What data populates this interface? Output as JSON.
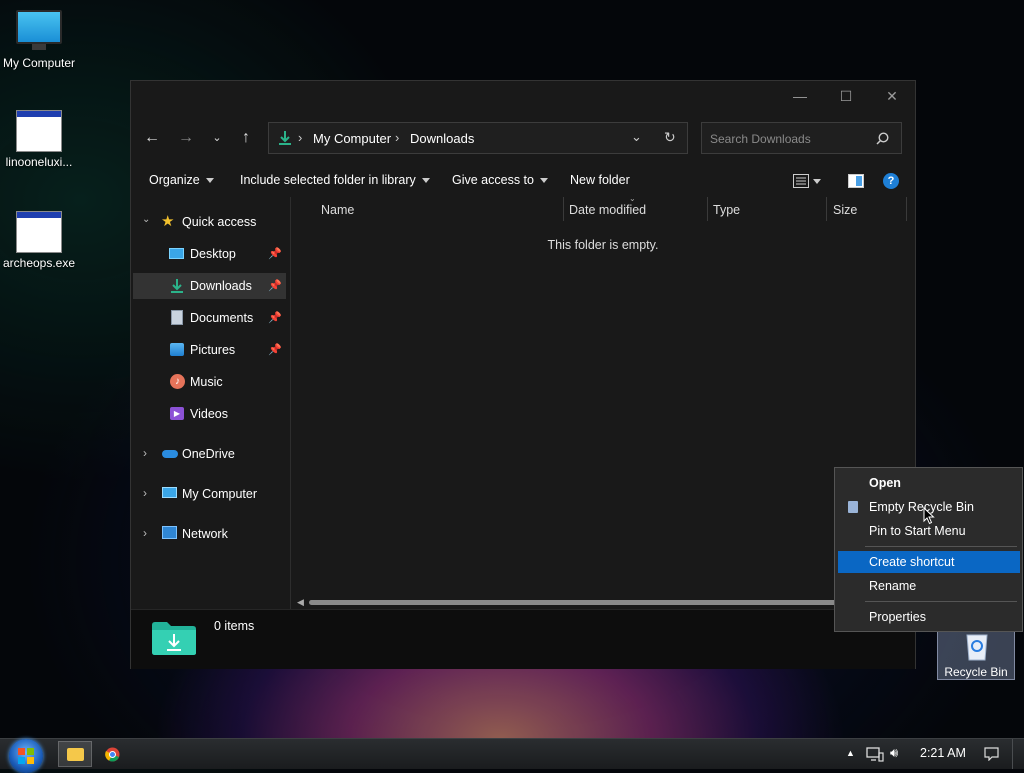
{
  "desktop": {
    "icons": [
      {
        "label": "My Computer"
      },
      {
        "label": "linooneluxi..."
      },
      {
        "label": "archeops.exe"
      }
    ],
    "recycle_bin_label": "Recycle Bin"
  },
  "explorer": {
    "controls": {
      "minimize": "—",
      "maximize": "☐",
      "close": "✕"
    },
    "breadcrumb": [
      "My Computer",
      "Downloads"
    ],
    "search_placeholder": "Search Downloads",
    "commands": [
      "Organize",
      "Include selected folder in library",
      "Give access to",
      "New folder"
    ],
    "nav": {
      "quick_access": "Quick access",
      "items": [
        {
          "label": "Desktop",
          "pinned": true
        },
        {
          "label": "Downloads",
          "pinned": true
        },
        {
          "label": "Documents",
          "pinned": true
        },
        {
          "label": "Pictures",
          "pinned": true
        },
        {
          "label": "Music",
          "pinned": false
        },
        {
          "label": "Videos",
          "pinned": false
        }
      ],
      "roots": [
        "OneDrive",
        "My Computer",
        "Network"
      ]
    },
    "columns": [
      "Name",
      "Date modified",
      "Type",
      "Size"
    ],
    "empty_message": "This folder is empty.",
    "status": "0 items"
  },
  "context_menu": {
    "items": [
      "Open",
      "Empty Recycle Bin",
      "Pin to Start Menu",
      "Create shortcut",
      "Rename",
      "Properties"
    ],
    "highlighted": "Create shortcut"
  },
  "taskbar": {
    "clock": "2:21 AM"
  },
  "colors": {
    "accent": "#0a67c4",
    "download_green": "#2bb38a",
    "window_bg": "#191919"
  }
}
